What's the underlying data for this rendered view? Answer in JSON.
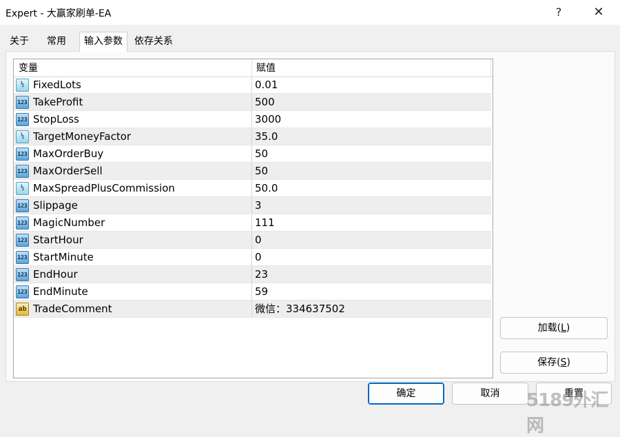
{
  "window": {
    "title": "Expert - 大赢家刷单-EA",
    "help_label": "?",
    "close_label": "✕"
  },
  "tabs": [
    {
      "label": "关于"
    },
    {
      "label": "常用"
    },
    {
      "label": "输入参数",
      "active": true
    },
    {
      "label": "依存关系"
    }
  ],
  "grid": {
    "headers": {
      "variable": "变量",
      "value": "赋值"
    },
    "rows": [
      {
        "icon": "double-type-icon",
        "icon_text": "½",
        "name": "FixedLots",
        "value": "0.01"
      },
      {
        "icon": "integer-type-icon",
        "icon_text": "123",
        "name": "TakeProfit",
        "value": "500"
      },
      {
        "icon": "integer-type-icon",
        "icon_text": "123",
        "name": "StopLoss",
        "value": "3000"
      },
      {
        "icon": "double-type-icon",
        "icon_text": "½",
        "name": "TargetMoneyFactor",
        "value": "35.0"
      },
      {
        "icon": "integer-type-icon",
        "icon_text": "123",
        "name": "MaxOrderBuy",
        "value": "50"
      },
      {
        "icon": "integer-type-icon",
        "icon_text": "123",
        "name": "MaxOrderSell",
        "value": "50"
      },
      {
        "icon": "double-type-icon",
        "icon_text": "½",
        "name": "MaxSpreadPlusCommission",
        "value": "50.0"
      },
      {
        "icon": "integer-type-icon",
        "icon_text": "123",
        "name": "Slippage",
        "value": "3"
      },
      {
        "icon": "integer-type-icon",
        "icon_text": "123",
        "name": "MagicNumber",
        "value": "111"
      },
      {
        "icon": "integer-type-icon",
        "icon_text": "123",
        "name": "StartHour",
        "value": "0"
      },
      {
        "icon": "integer-type-icon",
        "icon_text": "123",
        "name": "StartMinute",
        "value": "0"
      },
      {
        "icon": "integer-type-icon",
        "icon_text": "123",
        "name": "EndHour",
        "value": "23"
      },
      {
        "icon": "integer-type-icon",
        "icon_text": "123",
        "name": "EndMinute",
        "value": "59"
      },
      {
        "icon": "string-type-icon",
        "icon_text": "ab",
        "name": "TradeComment",
        "value": "微信：334637502"
      }
    ]
  },
  "buttons": {
    "load": {
      "text": "加载(",
      "accel": "L",
      "tail": ")"
    },
    "save": {
      "text": "保存(",
      "accel": "S",
      "tail": ")"
    },
    "ok": "确定",
    "cancel": "取消",
    "reset": "重置"
  },
  "watermark": "5189外汇网",
  "colors": {
    "accent": "#0067c0",
    "row_alt": "#eeeeee",
    "background": "#f0f0f0"
  }
}
